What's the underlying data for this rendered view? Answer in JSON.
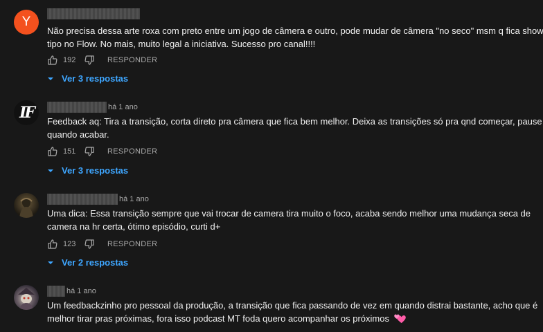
{
  "comments": [
    {
      "avatar_letter": "Y",
      "time": "",
      "text_lines": [
        "Não precisa dessa arte roxa com preto entre um jogo de câmera e outro, pode mudar de câmera \"no seco\" msm q fica show,",
        "tipo no Flow. No mais, muito legal a iniciativa. Sucesso pro canal!!!!"
      ],
      "likes": "192",
      "reply_label": "RESPONDER",
      "replies_label": "Ver 3 respostas"
    },
    {
      "avatar_letter": "IF",
      "time": "há 1 ano",
      "text_lines": [
        "Feedback aq: Tira a transição, corta direto pra câmera que fica bem melhor. Deixa as transições só pra qnd começar, pause e",
        "quando acabar."
      ],
      "likes": "151",
      "reply_label": "RESPONDER",
      "replies_label": "Ver 3 respostas"
    },
    {
      "time": "há 1 ano",
      "text_lines": [
        "Uma dica: Essa transição sempre que vai trocar de camera tira muito o foco, acaba sendo melhor uma mudança seca de",
        "camera na hr certa, ótimo episódio, curti d+"
      ],
      "likes": "123",
      "reply_label": "RESPONDER",
      "replies_label": "Ver 2 respostas"
    },
    {
      "time": "há 1 ano",
      "text_lines": [
        "Um feedbackzinho pro pessoal da produção, a transição que fica passando de vez em quando distrai bastante, acho que é",
        "melhor tirar pras próximas, fora isso podcast MT foda quero acompanhar os próximos"
      ],
      "emoji": "two-hearts-emoji"
    }
  ],
  "icons": {
    "like": "thumbs-up-icon",
    "dislike": "thumbs-down-icon",
    "expand": "chevron-down-icon"
  },
  "colors": {
    "background": "#181818",
    "link": "#3ea6ff",
    "secondary_text": "#aaaaaa",
    "avatar_y": "#f4511e"
  }
}
